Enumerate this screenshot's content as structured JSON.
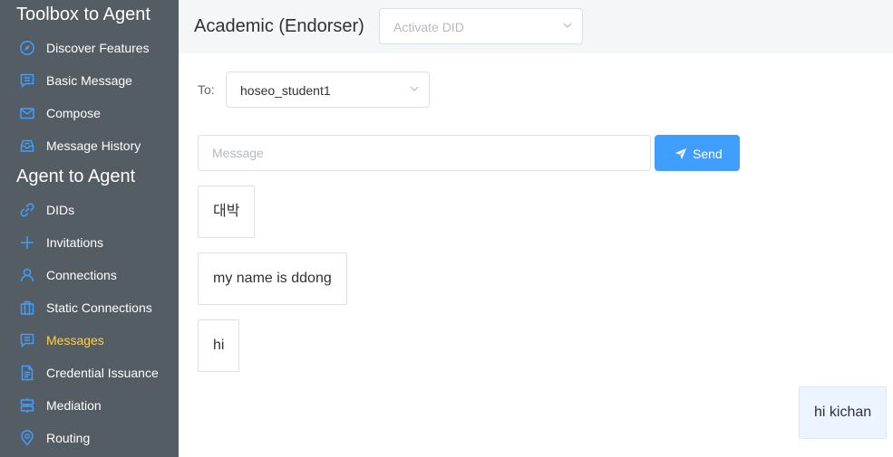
{
  "sidebar": {
    "sections": [
      {
        "title": "Toolbox to Agent"
      },
      {
        "title": "Agent to Agent"
      }
    ],
    "items": [
      {
        "label": "Discover Features",
        "icon": "compass-icon"
      },
      {
        "label": "Basic Message",
        "icon": "chat-icon"
      },
      {
        "label": "Compose",
        "icon": "envelope-icon"
      },
      {
        "label": "Message History",
        "icon": "inbox-icon"
      },
      {
        "label": "DIDs",
        "icon": "link-icon"
      },
      {
        "label": "Invitations",
        "icon": "plus-icon"
      },
      {
        "label": "Connections",
        "icon": "user-icon"
      },
      {
        "label": "Static Connections",
        "icon": "suitcase-icon"
      },
      {
        "label": "Messages",
        "icon": "chat-icon",
        "active": true
      },
      {
        "label": "Credential Issuance",
        "icon": "document-icon"
      },
      {
        "label": "Mediation",
        "icon": "server-icon"
      },
      {
        "label": "Routing",
        "icon": "location-icon"
      }
    ]
  },
  "header": {
    "title": "Academic (Endorser)",
    "did_select_placeholder": "Activate DID"
  },
  "compose": {
    "to_label": "To:",
    "to_value": "hoseo_student1",
    "message_placeholder": "Message",
    "message_value": "",
    "send_label": "Send"
  },
  "messages": [
    {
      "text": "대박",
      "direction": "received"
    },
    {
      "text": "my name is ddong",
      "direction": "received"
    },
    {
      "text": "hi",
      "direction": "received"
    },
    {
      "text": "hi kichan",
      "direction": "sent"
    }
  ],
  "colors": {
    "sidebar_bg": "#545c64",
    "sidebar_active_text": "#ffd04b",
    "icon_color": "#409eff",
    "primary": "#409eff",
    "sent_bubble_bg": "#ecf5ff"
  }
}
